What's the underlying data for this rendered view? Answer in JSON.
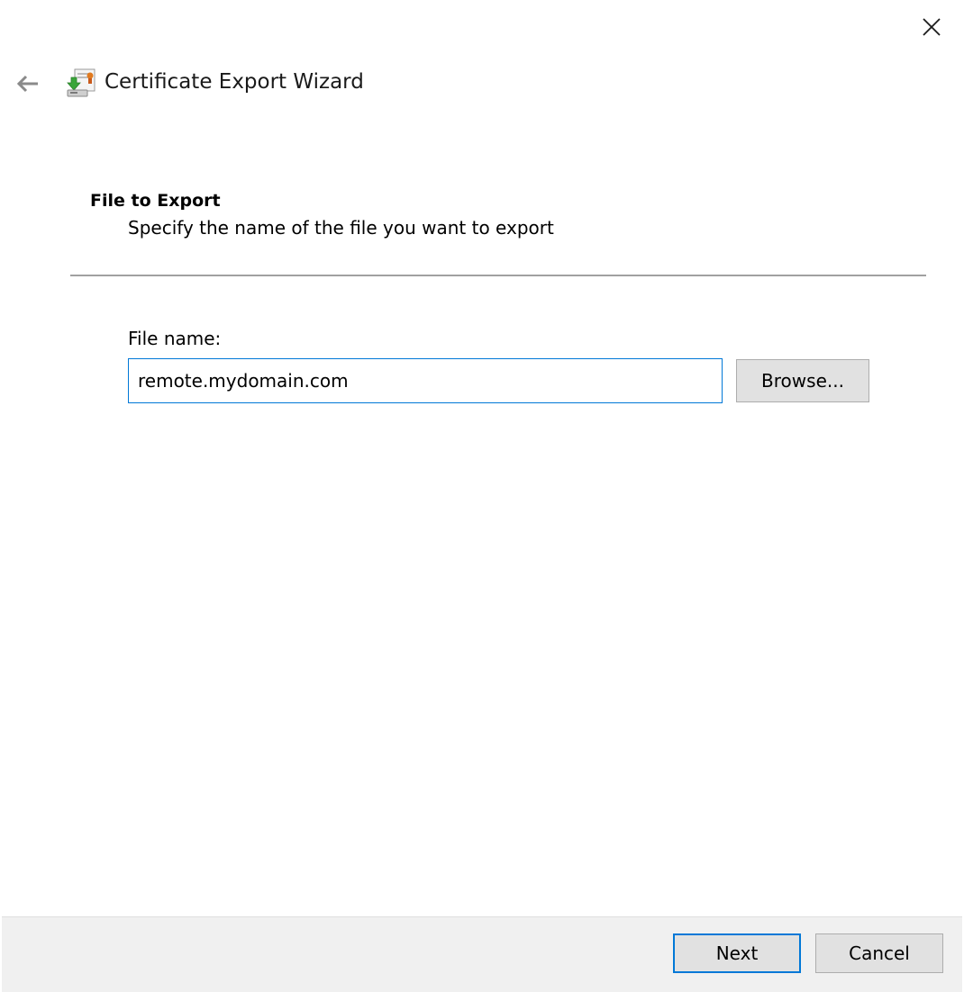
{
  "window": {
    "title": "Certificate Export Wizard"
  },
  "icons": {
    "close": "close-icon",
    "back": "back-arrow-icon",
    "app": "certificate-wizard-icon"
  },
  "section": {
    "title": "File to Export",
    "subtitle": "Specify the name of the file you want to export"
  },
  "file_name": {
    "label": "File name:",
    "value": "remote.mydomain.com"
  },
  "buttons": {
    "browse": "Browse...",
    "next": "Next",
    "cancel": "Cancel"
  },
  "colors": {
    "accent": "#0078d7",
    "footer_bg": "#f0f0f0",
    "button_bg": "#e1e1e1",
    "divider": "#a0a0a0"
  }
}
